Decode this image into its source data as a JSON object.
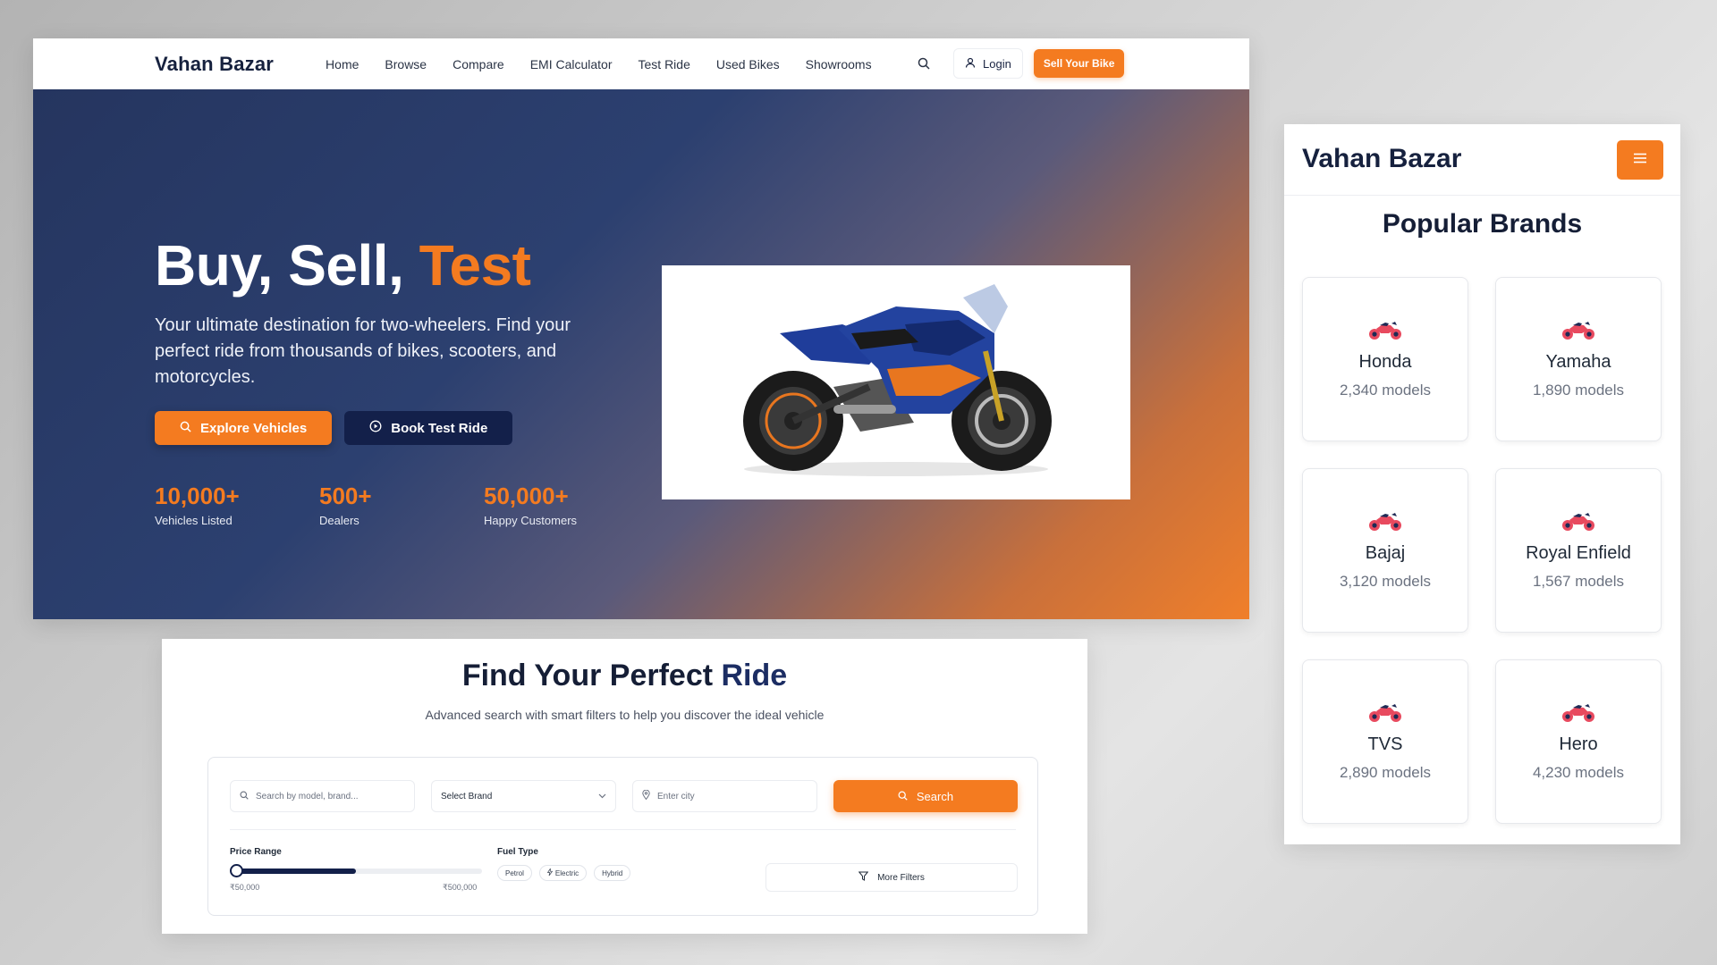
{
  "desktop": {
    "logo": "Vahan Bazar",
    "nav": [
      "Home",
      "Browse",
      "Compare",
      "EMI Calculator",
      "Test Ride",
      "Used Bikes",
      "Showrooms"
    ],
    "login": "Login",
    "sell": "Sell Your Bike",
    "hero": {
      "title_part1": "Buy, Sell, ",
      "title_accent": "Test",
      "description": "Your ultimate destination for two-wheelers. Find your perfect ride from thousands of bikes, scooters, and motorcycles.",
      "explore_btn": "Explore Vehicles",
      "test_btn": "Book Test Ride",
      "stats": [
        {
          "value": "10,000+",
          "label": "Vehicles Listed"
        },
        {
          "value": "500+",
          "label": "Dealers"
        },
        {
          "value": "50,000+",
          "label": "Happy Customers"
        }
      ]
    }
  },
  "search": {
    "title_part1": "Find Your Perfect ",
    "title_highlight": "Ride",
    "subtitle": "Advanced search with smart filters to help you discover the ideal vehicle",
    "query_placeholder": "Search by model, brand...",
    "brand_select": "Select Brand",
    "city_placeholder": "Enter city",
    "search_btn": "Search",
    "price_label": "Price Range",
    "price_min": "₹50,000",
    "price_max": "₹500,000",
    "price_fill_fraction": 0.49,
    "fuel_label": "Fuel Type",
    "fuel_options": [
      "Petrol",
      "Electric",
      "Hybrid"
    ],
    "more_filters": "More Filters"
  },
  "mobile": {
    "logo": "Vahan Bazar",
    "section_title": "Popular Brands",
    "brands": [
      {
        "name": "Honda",
        "models": "2,340 models"
      },
      {
        "name": "Yamaha",
        "models": "1,890 models"
      },
      {
        "name": "Bajaj",
        "models": "3,120 models"
      },
      {
        "name": "Royal Enfield",
        "models": "1,567 models"
      },
      {
        "name": "TVS",
        "models": "2,890 models"
      },
      {
        "name": "Hero",
        "models": "4,230 models"
      }
    ]
  },
  "colors": {
    "accent": "#f47b20",
    "navy": "#13204a",
    "brand_icon": "#e84a5f"
  }
}
